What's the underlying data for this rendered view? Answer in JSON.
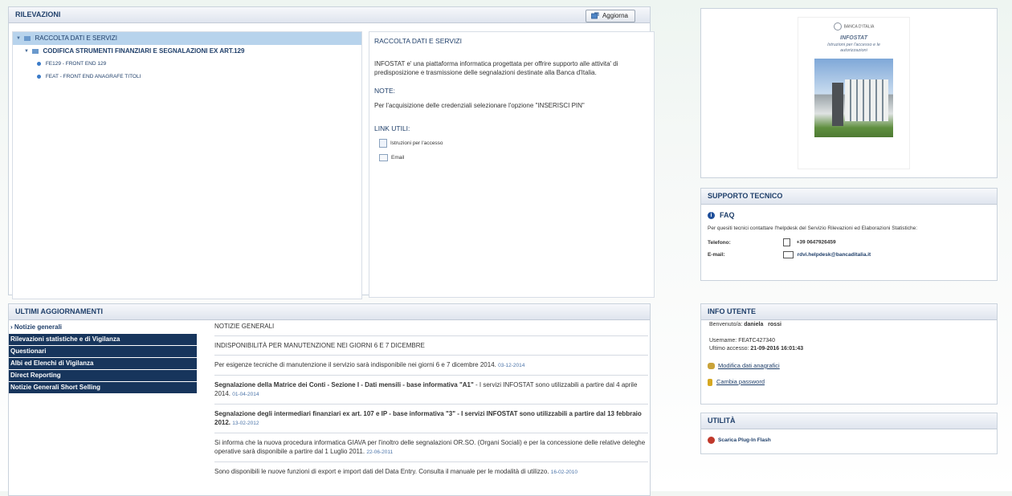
{
  "rilevazioni": {
    "title": "RILEVAZIONI",
    "refresh_label": "Aggiorna",
    "tree": [
      {
        "label": "RACCOLTA DATI E SERVIZI"
      },
      {
        "label": "CODIFICA STRUMENTI FINANZIARI E SEGNALAZIONI EX ART.129"
      },
      {
        "label": "FE129 - FRONT END 129"
      },
      {
        "label": "FEAT - FRONT END ANAGRAFE TITOLI"
      }
    ],
    "info": {
      "heading": "RACCOLTA DATI E SERVIZI",
      "description": "INFOSTAT e' una piattaforma informatica progettata per offrire supporto alle attivita' di predisposizione e trasmissione delle segnalazioni destinate alla Banca d'Italia.",
      "note_heading": "NOTE:",
      "note_text": "Per l'acquisizione delle credenziali selezionare l'opzione \"INSERISCI PIN\"",
      "links_heading": "LINK UTILI:",
      "links": [
        "Istruzioni per l'accesso",
        "Email"
      ]
    }
  },
  "infostat_card": {
    "logo_text": "BANCA D'ITALIA",
    "title": "INFOSTAT",
    "subtitle": "Istruzioni per l'accesso e le autorizzazioni"
  },
  "supporto": {
    "title": "SUPPORTO TECNICO",
    "faq_label": "FAQ",
    "text": "Per quesiti tecnici contattare l'helpdesk del Servizio Rilevazioni ed Elaborazioni Statistiche:",
    "phone_label": "Telefono:",
    "phone_value": "+39 0647926459",
    "email_label": "E-mail:",
    "email_value": "rdvi.helpdesk@bancaditalia.it"
  },
  "aggiornamenti": {
    "title": "ULTIMI AGGIORNAMENTI",
    "menu": [
      "› Notizie generali",
      "Rilevazioni statistiche e di Vigilanza",
      "Questionari",
      "Albi ed Elenchi di Vigilanza",
      "Direct Reporting",
      "Notizie Generali Short Selling"
    ],
    "section_title": "NOTIZIE GENERALI",
    "news": [
      {
        "title": "INDISPONIBILITÀ PER MANUTENZIONE NEI GIORNI 6 E 7 DICEMBRE",
        "text": "",
        "date": ""
      },
      {
        "title": "",
        "text": "Per esigenze tecniche di manutenzione il servizio sarà indisponibile nei giorni 6 e 7 dicembre 2014.",
        "date": "03-12-2014"
      },
      {
        "title": "Segnalazione della Matrice dei Conti - Sezione I - Dati mensili - base informativa \"A1\"",
        "text": " - I servizi INFOSTAT sono utilizzabili a partire dal 4 aprile 2014.",
        "date": "01-04-2014"
      },
      {
        "title": "Segnalazione degli intermediari finanziari ex art. 107 e IP - base informativa \"3\"",
        "text": " - I servizi INFOSTAT sono utilizzabili a partire dal 13 febbraio 2012.",
        "date": "13-02-2012"
      },
      {
        "title": "",
        "text": "Si informa che la nuova procedura informatica GIAVA per l'inoltro delle segnalazioni OR.SO. (Organi Sociali) e per la concessione delle relative deleghe operative sarà disponibile a partire dal 1 Luglio 2011.",
        "date": "22-06-2011"
      },
      {
        "title": "",
        "text": "Sono disponibili le nuove funzioni di export e import dati del Data Entry. Consulta il manuale per le modalità di utilizzo.",
        "date": "16-02-2010"
      }
    ]
  },
  "info_utente": {
    "title": "INFO UTENTE",
    "welcome_label": "Benvenuto/a:",
    "welcome_value": "daniela   rossi",
    "username_label": "Username:",
    "username_value": "FEATC427340",
    "last_access_label": "Ultimo accesso:",
    "last_access_value": "21-09-2016 16:01:43",
    "modify_link": "Modifica dati anagrafici",
    "password_link": "Cambia password"
  },
  "utilita": {
    "title": "UTILITÀ",
    "flash_link": "Scarica Plug-In Flash"
  },
  "colors": {
    "navy": "#17355c",
    "header_text": "#1f3f6a",
    "selection": "#b7d3ec",
    "link_blue": "#4a73a8"
  }
}
